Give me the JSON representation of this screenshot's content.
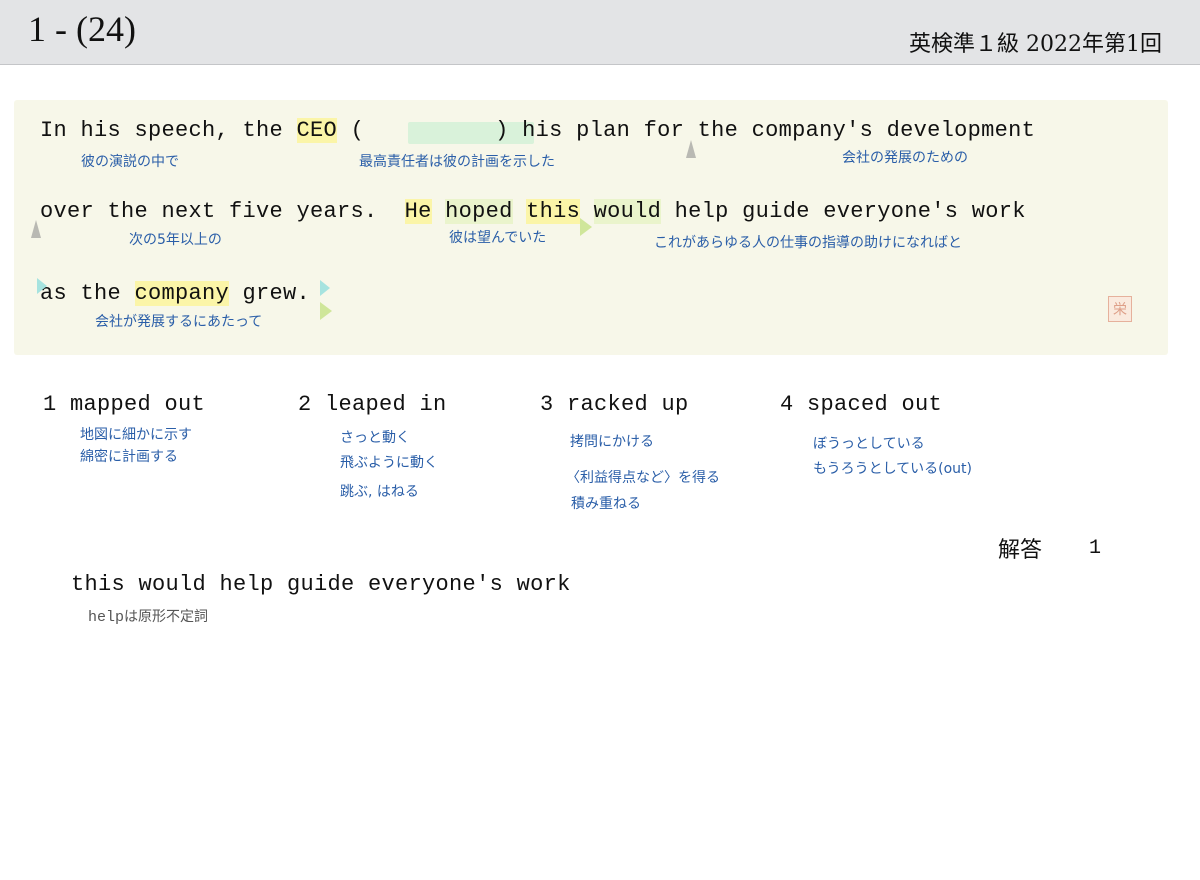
{
  "header": {
    "question_number": "1 - (24)",
    "exam_label": "英検準１級  2022年第1回"
  },
  "sentence": {
    "line1": {
      "p1": "In his speech, the ",
      "ceo": "CEO",
      "p2": " (",
      "p3": ") his plan for the company's development"
    },
    "line2": {
      "p1": "over the next five years.  ",
      "he": "He",
      "sp": " ",
      "hoped": "hoped",
      "sp2": " ",
      "this": "this",
      "sp3": " ",
      "would": "would",
      "rest": " help guide everyone's work"
    },
    "line3": {
      "p1": "as the ",
      "company": "company",
      "rest": " grew."
    }
  },
  "glosses": {
    "in_his_speech": "彼の演説の中で",
    "ceo_showed": "最高責任者は彼の計画を示した",
    "company_dev": "会社の発展のための",
    "next_five": "次の5年以上の",
    "he_hoped": "彼は望んでいた",
    "guide_work": "これがあらゆる人の仕事の指導の助けになればと",
    "company_grew": "会社が発展するにあたって"
  },
  "options": [
    {
      "num": "1",
      "text": "mapped out",
      "glosses": [
        "地図に細かに示す",
        "綿密に計画する"
      ]
    },
    {
      "num": "2",
      "text": "leaped in",
      "glosses": [
        "さっと動く",
        "飛ぶように動く",
        "跳ぶ, はねる"
      ]
    },
    {
      "num": "3",
      "text": "racked up",
      "glosses": [
        "拷問にかける",
        "〈利益得点など〉を得る",
        "積み重ねる"
      ]
    },
    {
      "num": "4",
      "text": "spaced out",
      "glosses": [
        "ぼうっとしている",
        "もうろうとしている(out)"
      ]
    }
  ],
  "answer": {
    "label": "解答",
    "value": "1"
  },
  "grammar_note": {
    "phrase": "this would help guide everyone's work",
    "note_mono": "help",
    "note_rest": "は原形不定詞"
  },
  "colors": {
    "gloss_blue": "#2a5ea8",
    "highlight_yellow": "#fbf5a8",
    "blank_green": "#d9f2da",
    "panel_bg": "#f7f7e9"
  }
}
